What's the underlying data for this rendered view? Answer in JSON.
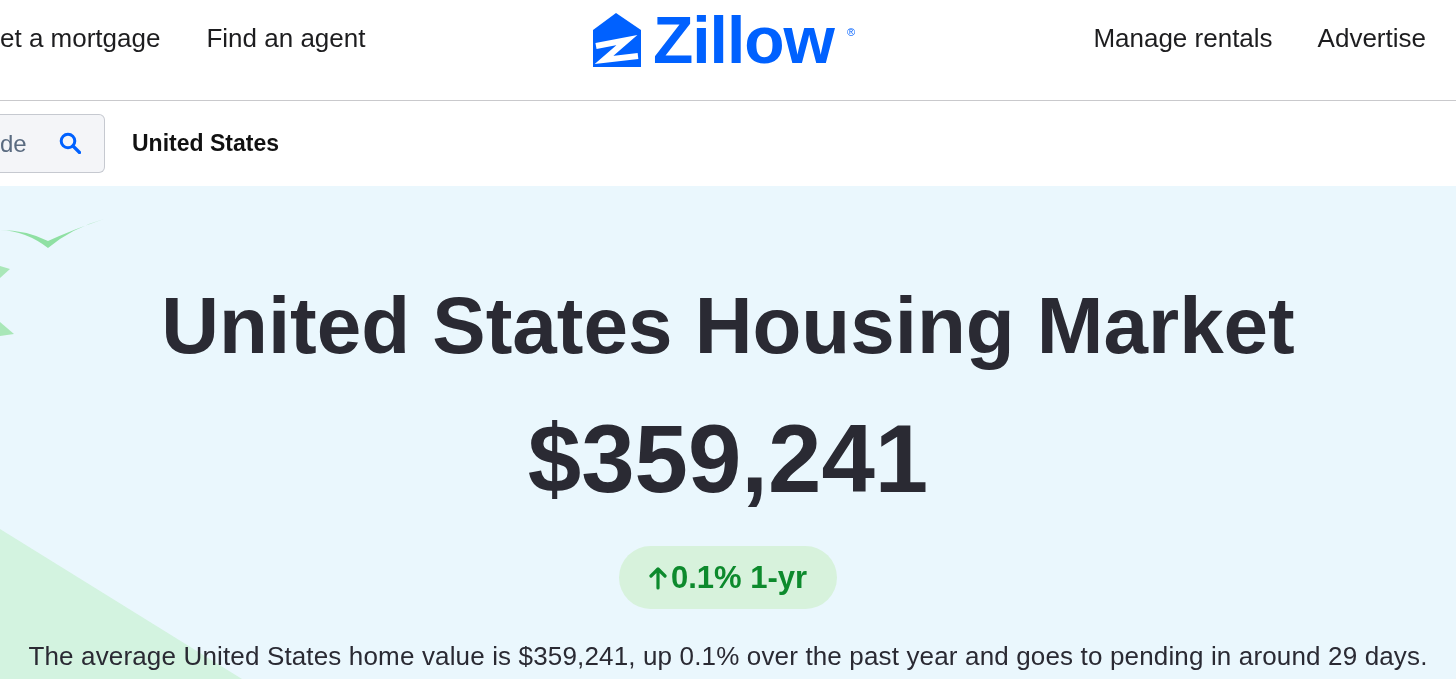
{
  "header": {
    "nav_left": [
      "et a mortgage",
      "Find an agent"
    ],
    "logo": {
      "text": "Zillow",
      "mark": "®"
    },
    "nav_right": [
      "Manage rentals",
      "Advertise"
    ]
  },
  "search": {
    "placeholder": "de"
  },
  "location": "United States",
  "hero": {
    "title": "United States Housing Market",
    "value": "$359,241",
    "change": {
      "rising": true,
      "text": "0.1% 1-yr"
    },
    "summary": "The average United States home value is $359,241, up 0.1% over the past year and goes to pending in around 29 days."
  }
}
